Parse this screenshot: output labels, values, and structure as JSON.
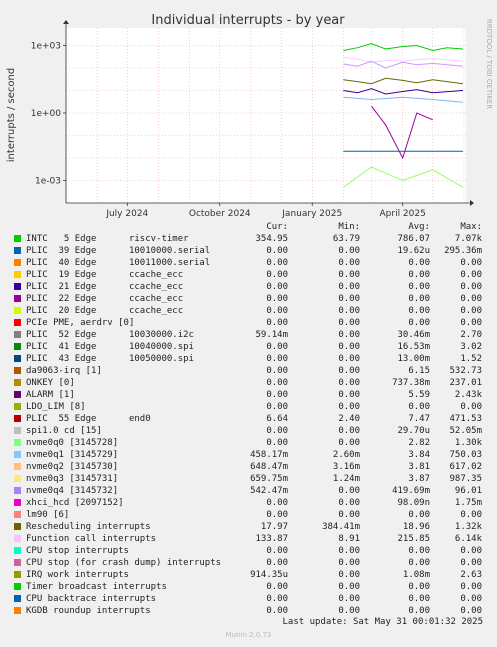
{
  "chart_data": {
    "type": "line",
    "title": "Individual interrupts - by year",
    "ylabel": "interrupts / second",
    "side_label": "RRDTOOL / TOBI OETIKER",
    "y_scale": "log",
    "ylim": [
      0.0001,
      6000
    ],
    "y_ticks": [
      {
        "value": 1000,
        "label": "1e+03"
      },
      {
        "value": 1,
        "label": "1e+00"
      },
      {
        "value": 0.001,
        "label": "1e-03"
      }
    ],
    "xlim": [
      "2024-05-01",
      "2025-06-03"
    ],
    "x_ticks": [
      {
        "date": "2024-07-01",
        "label": "July 2024"
      },
      {
        "date": "2024-10-01",
        "label": "October 2024"
      },
      {
        "date": "2025-01-01",
        "label": "January 2025"
      },
      {
        "date": "2025-04-01",
        "label": "April 2025"
      }
    ],
    "grid": true,
    "data_start": "2025-02-01",
    "series_lines": [
      {
        "name": "INTC 5 Edge riscv-timer",
        "color": "#00cc00",
        "points": [
          [
            "2025-02-01",
            600
          ],
          [
            "2025-02-15",
            800
          ],
          [
            "2025-03-01",
            1200
          ],
          [
            "2025-03-15",
            700
          ],
          [
            "2025-04-01",
            900
          ],
          [
            "2025-04-15",
            1000
          ],
          [
            "2025-05-01",
            600
          ],
          [
            "2025-05-15",
            800
          ],
          [
            "2025-05-31",
            700
          ]
        ]
      },
      {
        "name": "Function call interrupts",
        "color": "#ffccff",
        "points": [
          [
            "2025-02-01",
            300
          ],
          [
            "2025-02-15",
            250
          ],
          [
            "2025-03-01",
            180
          ],
          [
            "2025-03-15",
            220
          ],
          [
            "2025-04-01",
            200
          ],
          [
            "2025-04-15",
            240
          ],
          [
            "2025-05-01",
            260
          ],
          [
            "2025-05-31",
            200
          ]
        ]
      },
      {
        "name": "nvme0q4",
        "color": "#cc99ff",
        "points": [
          [
            "2025-02-01",
            150
          ],
          [
            "2025-02-15",
            120
          ],
          [
            "2025-03-01",
            200
          ],
          [
            "2025-03-15",
            100
          ],
          [
            "2025-04-01",
            180
          ],
          [
            "2025-04-15",
            140
          ],
          [
            "2025-05-01",
            160
          ],
          [
            "2025-05-31",
            120
          ]
        ]
      },
      {
        "name": "Rescheduling interrupts",
        "color": "#666600",
        "points": [
          [
            "2025-02-01",
            30
          ],
          [
            "2025-02-15",
            25
          ],
          [
            "2025-03-01",
            20
          ],
          [
            "2025-03-15",
            35
          ],
          [
            "2025-04-01",
            28
          ],
          [
            "2025-04-15",
            22
          ],
          [
            "2025-05-01",
            30
          ],
          [
            "2025-05-31",
            20
          ]
        ]
      },
      {
        "name": "PLIC 55 Edge end0",
        "color": "#330099",
        "points": [
          [
            "2025-02-01",
            10
          ],
          [
            "2025-02-15",
            8
          ],
          [
            "2025-03-01",
            12
          ],
          [
            "2025-03-15",
            7
          ],
          [
            "2025-04-01",
            9
          ],
          [
            "2025-04-15",
            11
          ],
          [
            "2025-05-01",
            8
          ],
          [
            "2025-05-31",
            10
          ]
        ]
      },
      {
        "name": "nvme0q1",
        "color": "#80b3ff",
        "points": [
          [
            "2025-02-01",
            5
          ],
          [
            "2025-03-01",
            4
          ],
          [
            "2025-04-01",
            5
          ],
          [
            "2025-05-01",
            4
          ],
          [
            "2025-05-31",
            3
          ]
        ]
      },
      {
        "name": "PLIC 22 Edge ccache_ecc",
        "color": "#990099",
        "points": [
          [
            "2025-03-01",
            2
          ],
          [
            "2025-03-15",
            0.3
          ],
          [
            "2025-04-01",
            0.01
          ],
          [
            "2025-04-15",
            1
          ],
          [
            "2025-05-01",
            0.5
          ]
        ]
      },
      {
        "name": "PLIC 43 Edge 10050000.spi",
        "color": "#006699",
        "points": [
          [
            "2025-02-01",
            0.02
          ],
          [
            "2025-03-01",
            0.02
          ],
          [
            "2025-04-01",
            0.02
          ],
          [
            "2025-05-01",
            0.02
          ],
          [
            "2025-05-31",
            0.02
          ]
        ]
      },
      {
        "name": "spi1.0 cd [15]",
        "color": "#99ff66",
        "points": [
          [
            "2025-02-01",
            0.0005
          ],
          [
            "2025-03-01",
            0.004
          ],
          [
            "2025-04-01",
            0.001
          ],
          [
            "2025-05-01",
            0.003
          ],
          [
            "2025-05-31",
            0.0005
          ]
        ]
      }
    ],
    "columns": [
      "Cur:",
      "Min:",
      "Avg:",
      "Max:"
    ],
    "series": [
      {
        "color": "#00cc00",
        "label": "INTC   5 Edge      riscv-timer",
        "cur": "354.95",
        "min": "63.79",
        "avg": "786.07",
        "max": "7.07k"
      },
      {
        "color": "#0066b3",
        "label": "PLIC  39 Edge      10010000.serial",
        "cur": "0.00",
        "min": "0.00",
        "avg": "19.62u",
        "max": "295.36m"
      },
      {
        "color": "#ff8000",
        "label": "PLIC  40 Edge      10011000.serial",
        "cur": "0.00",
        "min": "0.00",
        "avg": "0.00",
        "max": "0.00"
      },
      {
        "color": "#ffcc00",
        "label": "PLIC  19 Edge      ccache_ecc",
        "cur": "0.00",
        "min": "0.00",
        "avg": "0.00",
        "max": "0.00"
      },
      {
        "color": "#330099",
        "label": "PLIC  21 Edge      ccache_ecc",
        "cur": "0.00",
        "min": "0.00",
        "avg": "0.00",
        "max": "0.00"
      },
      {
        "color": "#990099",
        "label": "PLIC  22 Edge      ccache_ecc",
        "cur": "0.00",
        "min": "0.00",
        "avg": "0.00",
        "max": "0.00"
      },
      {
        "color": "#ccff00",
        "label": "PLIC  20 Edge      ccache_ecc",
        "cur": "0.00",
        "min": "0.00",
        "avg": "0.00",
        "max": "0.00"
      },
      {
        "color": "#ff0000",
        "label": "PCIe PME, aerdrv [0]",
        "cur": "0.00",
        "min": "0.00",
        "avg": "0.00",
        "max": "0.00"
      },
      {
        "color": "#808080",
        "label": "PLIC  52 Edge      10030000.i2c",
        "cur": "59.14m",
        "min": "0.00",
        "avg": "30.46m",
        "max": "2.70"
      },
      {
        "color": "#008f00",
        "label": "PLIC  41 Edge      10040000.spi",
        "cur": "0.00",
        "min": "0.00",
        "avg": "16.53m",
        "max": "3.02"
      },
      {
        "color": "#00487d",
        "label": "PLIC  43 Edge      10050000.spi",
        "cur": "0.00",
        "min": "0.00",
        "avg": "13.00m",
        "max": "1.52"
      },
      {
        "color": "#b35a00",
        "label": "da9063-irq [1]",
        "cur": "0.00",
        "min": "0.00",
        "avg": "6.15",
        "max": "532.73"
      },
      {
        "color": "#b38f00",
        "label": "ONKEY [0]",
        "cur": "0.00",
        "min": "0.00",
        "avg": "737.38m",
        "max": "237.01"
      },
      {
        "color": "#6b006b",
        "label": "ALARM [1]",
        "cur": "0.00",
        "min": "0.00",
        "avg": "5.59",
        "max": "2.43k"
      },
      {
        "color": "#8fb300",
        "label": "LDO_LIM [8]",
        "cur": "0.00",
        "min": "0.00",
        "avg": "0.00",
        "max": "0.00"
      },
      {
        "color": "#b30000",
        "label": "PLIC  55 Edge      end0",
        "cur": "6.64",
        "min": "2.40",
        "avg": "7.47",
        "max": "471.53"
      },
      {
        "color": "#bebebe",
        "label": "spi1.0 cd [15]",
        "cur": "0.00",
        "min": "0.00",
        "avg": "29.70u",
        "max": "52.05m"
      },
      {
        "color": "#80ff80",
        "label": "nvme0q0 [3145728]",
        "cur": "0.00",
        "min": "0.00",
        "avg": "2.82",
        "max": "1.30k"
      },
      {
        "color": "#80c9ff",
        "label": "nvme0q1 [3145729]",
        "cur": "458.17m",
        "min": "2.60m",
        "avg": "3.84",
        "max": "750.03"
      },
      {
        "color": "#ffc080",
        "label": "nvme0q2 [3145730]",
        "cur": "648.47m",
        "min": "3.16m",
        "avg": "3.81",
        "max": "617.02"
      },
      {
        "color": "#ffe680",
        "label": "nvme0q3 [3145731]",
        "cur": "659.75m",
        "min": "1.24m",
        "avg": "3.87",
        "max": "987.35"
      },
      {
        "color": "#aa80ff",
        "label": "nvme0q4 [3145732]",
        "cur": "542.47m",
        "min": "0.00",
        "avg": "419.69m",
        "max": "96.01"
      },
      {
        "color": "#ee00cc",
        "label": "xhci_hcd [2097152]",
        "cur": "0.00",
        "min": "0.00",
        "avg": "98.09n",
        "max": "1.75m"
      },
      {
        "color": "#ff8080",
        "label": "lm90 [6]",
        "cur": "0.00",
        "min": "0.00",
        "avg": "0.00",
        "max": "0.00"
      },
      {
        "color": "#666600",
        "label": "Rescheduling interrupts",
        "cur": "17.97",
        "min": "384.41m",
        "avg": "18.96",
        "max": "1.32k"
      },
      {
        "color": "#ffbfff",
        "label": "Function call interrupts",
        "cur": "133.87",
        "min": "8.91",
        "avg": "215.85",
        "max": "6.14k"
      },
      {
        "color": "#00ffcc",
        "label": "CPU stop interrupts",
        "cur": "0.00",
        "min": "0.00",
        "avg": "0.00",
        "max": "0.00"
      },
      {
        "color": "#cc6699",
        "label": "CPU stop (for crash dump) interrupts",
        "cur": "0.00",
        "min": "0.00",
        "avg": "0.00",
        "max": "0.00"
      },
      {
        "color": "#999900",
        "label": "IRQ work interrupts",
        "cur": "914.35u",
        "min": "0.00",
        "avg": "1.08m",
        "max": "2.63"
      },
      {
        "color": "#00cc00",
        "label": "Timer broadcast interrupts",
        "cur": "0.00",
        "min": "0.00",
        "avg": "0.00",
        "max": "0.00"
      },
      {
        "color": "#0066b3",
        "label": "CPU backtrace interrupts",
        "cur": "0.00",
        "min": "0.00",
        "avg": "0.00",
        "max": "0.00"
      },
      {
        "color": "#ff8000",
        "label": "KGDB roundup interrupts",
        "cur": "0.00",
        "min": "0.00",
        "avg": "0.00",
        "max": "0.00"
      }
    ]
  },
  "footer": {
    "last_update": "Last update: Sat May 31 00:01:32 2025",
    "version": "Munin 2.0.73"
  }
}
